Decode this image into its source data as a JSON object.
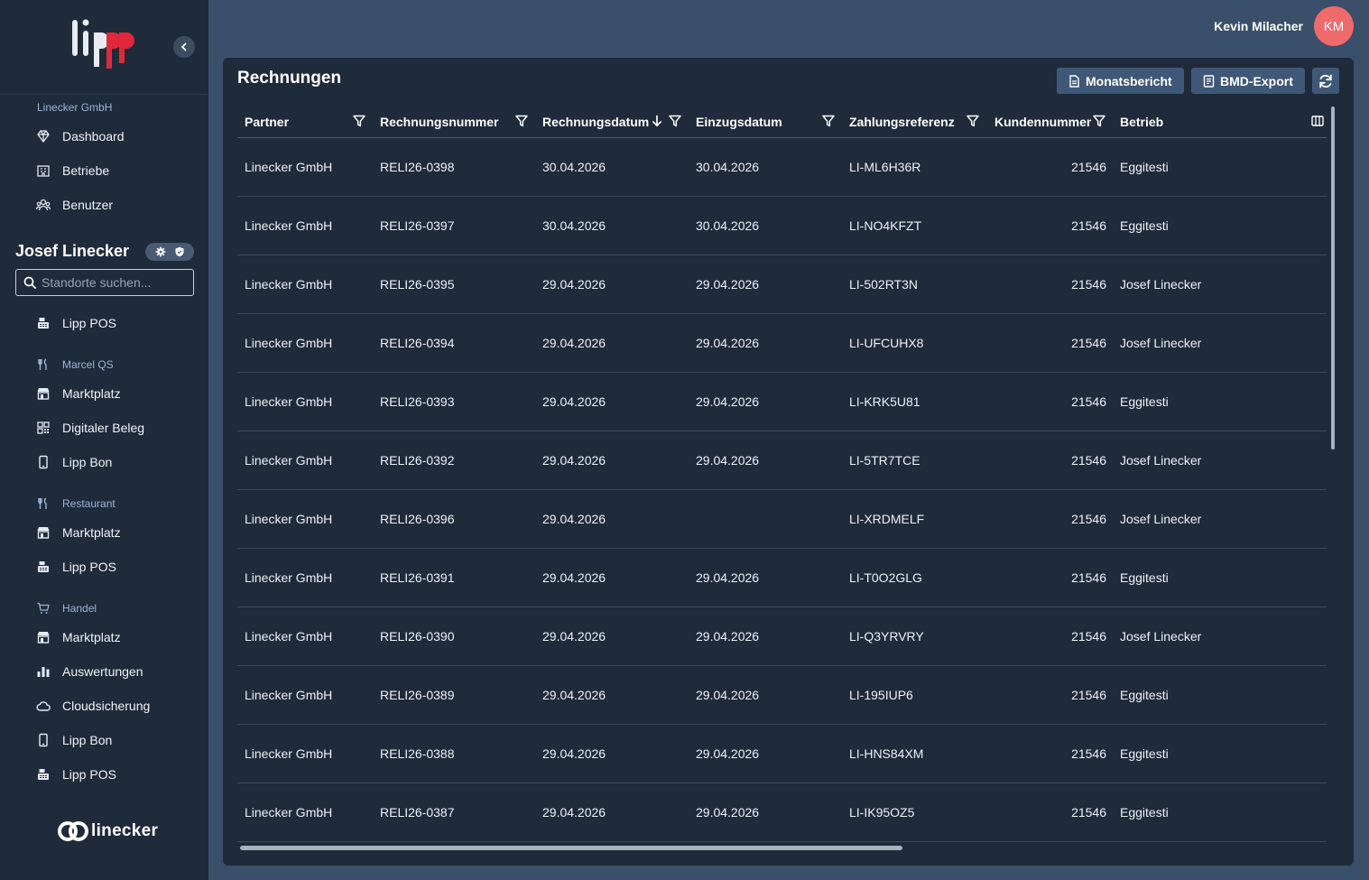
{
  "sidebar": {
    "org_label": "Linecker GmbH",
    "collapse_icon": "chevron-left-icon",
    "top_items": [
      {
        "label": "Dashboard",
        "icon": "gem-icon"
      },
      {
        "label": "Betriebe",
        "icon": "building-icon"
      },
      {
        "label": "Benutzer",
        "icon": "users-icon"
      }
    ],
    "user_name": "Josef Linecker",
    "user_badges": [
      "gear-icon",
      "shield-icon"
    ],
    "search": {
      "placeholder": "Standorte suchen...",
      "value": ""
    },
    "location_item": {
      "label": "Lipp POS",
      "icon": "cash-register-icon"
    },
    "groups": [
      {
        "label": "Marcel QS",
        "icon": "utensils-icon",
        "items": [
          {
            "label": "Marktplatz",
            "icon": "store-icon"
          },
          {
            "label": "Digitaler Beleg",
            "icon": "qr-code-icon"
          },
          {
            "label": "Lipp Bon",
            "icon": "phone-icon"
          }
        ]
      },
      {
        "label": "Restaurant",
        "icon": "utensils-icon",
        "items": [
          {
            "label": "Marktplatz",
            "icon": "store-icon"
          },
          {
            "label": "Lipp POS",
            "icon": "cash-register-icon"
          }
        ]
      },
      {
        "label": "Handel",
        "icon": "cart-icon",
        "items": [
          {
            "label": "Marktplatz",
            "icon": "store-icon"
          },
          {
            "label": "Auswertungen",
            "icon": "bar-chart-icon"
          },
          {
            "label": "Cloudsicherung",
            "icon": "cloud-icon"
          },
          {
            "label": "Lipp Bon",
            "icon": "phone-icon"
          },
          {
            "label": "Lipp POS",
            "icon": "cash-register-icon"
          }
        ]
      }
    ],
    "footer_brand": "linecker"
  },
  "topbar": {
    "user_name": "Kevin Milacher",
    "avatar_initials": "KM",
    "avatar_color": "#ef6b6b"
  },
  "card": {
    "title": "Rechnungen",
    "buttons": {
      "monthly_report": "Monatsbericht",
      "bmd_export": "BMD-Export",
      "refresh_icon": "refresh-icon"
    },
    "columns": [
      {
        "key": "partner",
        "label": "Partner",
        "filter": true
      },
      {
        "key": "invoice_no",
        "label": "Rechnungsnummer",
        "filter": true
      },
      {
        "key": "invoice_date",
        "label": "Rechnungsdatum",
        "filter": true,
        "sort": "desc"
      },
      {
        "key": "collection_date",
        "label": "Einzugsdatum",
        "filter": true
      },
      {
        "key": "payment_ref",
        "label": "Zahlungsreferenz",
        "filter": true
      },
      {
        "key": "customer_no",
        "label": "Kundennummer",
        "filter": true
      },
      {
        "key": "business",
        "label": "Betrieb",
        "filter": false
      }
    ],
    "rows": [
      {
        "partner": "Linecker GmbH",
        "invoice_no": "RELI26-0398",
        "invoice_date": "30.04.2026",
        "collection_date": "30.04.2026",
        "payment_ref": "LI-ML6H36R",
        "customer_no": "21546",
        "business": "Eggitesti"
      },
      {
        "partner": "Linecker GmbH",
        "invoice_no": "RELI26-0397",
        "invoice_date": "30.04.2026",
        "collection_date": "30.04.2026",
        "payment_ref": "LI-NO4KFZT",
        "customer_no": "21546",
        "business": "Eggitesti"
      },
      {
        "partner": "Linecker GmbH",
        "invoice_no": "RELI26-0395",
        "invoice_date": "29.04.2026",
        "collection_date": "29.04.2026",
        "payment_ref": "LI-502RT3N",
        "customer_no": "21546",
        "business": "Josef Linecker"
      },
      {
        "partner": "Linecker GmbH",
        "invoice_no": "RELI26-0394",
        "invoice_date": "29.04.2026",
        "collection_date": "29.04.2026",
        "payment_ref": "LI-UFCUHX8",
        "customer_no": "21546",
        "business": "Josef Linecker"
      },
      {
        "partner": "Linecker GmbH",
        "invoice_no": "RELI26-0393",
        "invoice_date": "29.04.2026",
        "collection_date": "29.04.2026",
        "payment_ref": "LI-KRK5U81",
        "customer_no": "21546",
        "business": "Eggitesti"
      },
      {
        "partner": "Linecker GmbH",
        "invoice_no": "RELI26-0392",
        "invoice_date": "29.04.2026",
        "collection_date": "29.04.2026",
        "payment_ref": "LI-5TR7TCE",
        "customer_no": "21546",
        "business": "Josef Linecker"
      },
      {
        "partner": "Linecker GmbH",
        "invoice_no": "RELI26-0396",
        "invoice_date": "29.04.2026",
        "collection_date": "",
        "payment_ref": "LI-XRDMELF",
        "customer_no": "21546",
        "business": "Josef Linecker"
      },
      {
        "partner": "Linecker GmbH",
        "invoice_no": "RELI26-0391",
        "invoice_date": "29.04.2026",
        "collection_date": "29.04.2026",
        "payment_ref": "LI-T0O2GLG",
        "customer_no": "21546",
        "business": "Eggitesti"
      },
      {
        "partner": "Linecker GmbH",
        "invoice_no": "RELI26-0390",
        "invoice_date": "29.04.2026",
        "collection_date": "29.04.2026",
        "payment_ref": "LI-Q3YRVRY",
        "customer_no": "21546",
        "business": "Josef Linecker"
      },
      {
        "partner": "Linecker GmbH",
        "invoice_no": "RELI26-0389",
        "invoice_date": "29.04.2026",
        "collection_date": "29.04.2026",
        "payment_ref": "LI-195IUP6",
        "customer_no": "21546",
        "business": "Eggitesti"
      },
      {
        "partner": "Linecker GmbH",
        "invoice_no": "RELI26-0388",
        "invoice_date": "29.04.2026",
        "collection_date": "29.04.2026",
        "payment_ref": "LI-HNS84XM",
        "customer_no": "21546",
        "business": "Eggitesti"
      },
      {
        "partner": "Linecker GmbH",
        "invoice_no": "RELI26-0387",
        "invoice_date": "29.04.2026",
        "collection_date": "29.04.2026",
        "payment_ref": "LI-IK95OZ5",
        "customer_no": "21546",
        "business": "Eggitesti"
      }
    ]
  },
  "colors": {
    "page_bg": "#3a4f69",
    "panel_bg": "#1f2a3a",
    "button_bg": "#3f5877",
    "logo_red": "#e0283a",
    "muted_label": "#9fb4d8"
  }
}
